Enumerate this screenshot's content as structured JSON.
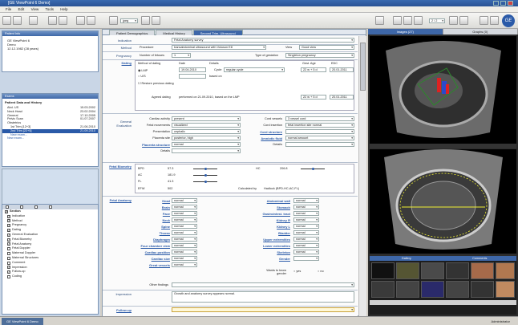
{
  "window": {
    "title": "[GE ViewPoint 6 Demo]"
  },
  "menu": [
    "File",
    "Edit",
    "View",
    "Tools",
    "Help"
  ],
  "toolbar": {
    "zoom": "jpeg",
    "page_sel": "2 / 2"
  },
  "patient_info": {
    "header": "Patient Info",
    "line1": "GE ViewPoint 6",
    "line2": "Demo",
    "line3": "12.12.1982 (28 years)"
  },
  "exams": {
    "header": "Exams",
    "title": "Patient Data and History",
    "rows": [
      {
        "name": "Abd. US",
        "date": "15.03.2002"
      },
      {
        "name": "Neck Head",
        "date": "23.02.2004"
      },
      {
        "name": "General",
        "date": "17.10.2005"
      },
      {
        "name": "Pelvic Scan",
        "date": "01.07.2007"
      },
      {
        "name": "Obstetrics",
        "date": ""
      },
      {
        "name": "1st Trim.[12+3]",
        "date": "21.06.2010"
      },
      {
        "name": "2nd Trim.[22+5]",
        "date": "21.09.2010"
      },
      {
        "name": "New exam...",
        "date": ""
      },
      {
        "name": "New exam...",
        "date": ""
      }
    ]
  },
  "sections": {
    "header": "Section",
    "items": [
      {
        "label": "Indication",
        "checked": true
      },
      {
        "label": "Method",
        "checked": true
      },
      {
        "label": "Pregnancy",
        "checked": true
      },
      {
        "label": "Dating",
        "checked": true
      },
      {
        "label": "General Evaluation",
        "checked": true
      },
      {
        "label": "Fetal Biometry",
        "checked": true
      },
      {
        "label": "Fetal Anatomy",
        "checked": true
      },
      {
        "label": "Fetal Doppler",
        "checked": false
      },
      {
        "label": "Maternal Doppler",
        "checked": false
      },
      {
        "label": "Maternal Structures",
        "checked": false
      },
      {
        "label": "Comment",
        "checked": false
      },
      {
        "label": "Impression",
        "checked": true
      },
      {
        "label": "Follow-up",
        "checked": true
      },
      {
        "label": "Coding",
        "checked": false
      }
    ]
  },
  "tabs": [
    "Patient Demographics",
    "Medical History",
    "Second Trim. Ultrasound"
  ],
  "form": {
    "indication_label": "Indication",
    "indication_val": "Fetal Anatomy survey",
    "method_label": "Method",
    "procedure_label": "Procedure",
    "procedure_val": "transabdominal ultrasound with Voluson E8",
    "view_label": "View",
    "view_val": "Good view",
    "pregnancy_label": "Pregnancy",
    "fetuses_label": "Number of fetuses",
    "fetuses_val": "1",
    "gestation_label": "Type of gestation",
    "gestation_val": "Singleton pregnancy",
    "dating_label": "Dating",
    "dating_hdr": [
      "Method of dating",
      "Date",
      "Details",
      "Gest. Age",
      "EDC"
    ],
    "lmp": "LMP",
    "lmp_date": "19.04.2010",
    "cycle_label": "Cycle",
    "cycle_val": "regular cycle",
    "lmp_ga": "22 w + 5 d",
    "lmp_edc": "20.01.2011",
    "us": "U/S",
    "based_on": "based on",
    "restore": "Restore previous dating",
    "agreed_label": "Agreed dating",
    "agreed_val": "performed on 21.09.2010, based on the LMP",
    "agreed_ga": "22 w + 5 d",
    "agreed_edc": "20.01.2011",
    "genev_label": "General Evaluation",
    "cardiac_activity": "Cardiac activity",
    "cardiac_activity_val": "present",
    "fetal_movements": "Fetal movements",
    "fetal_movements_val": "visualized",
    "presentation": "Presentation",
    "presentation_val": "cephalic",
    "placenta_site": "Placenta site",
    "placenta_site_val": "posterior, high",
    "placenta_structure": "Placenta structure",
    "placenta_structure_val": "normal",
    "details": "Details",
    "cord_vessels": "Cord vessels",
    "cord_vessels_val": "3 vessel cord",
    "cord_insertion": "Cord insertion",
    "cord_insertion_val": "fetal insertion site normal",
    "cord_structure": "Cord structure",
    "amniotic_fluid": "Amniotic fluid",
    "amniotic_fluid_val": "normal amount",
    "biometry_label": "Fetal Biometry",
    "biometry_rows": [
      {
        "name": "BPD",
        "val": "57.3",
        "name2": "HC",
        "val2": "206.8"
      },
      {
        "name": "AC",
        "val": "181.9",
        "name2": "",
        "val2": ""
      },
      {
        "name": "FL",
        "val": "41.3",
        "name2": "",
        "val2": ""
      }
    ],
    "efw_label": "EFW",
    "efw_val": "502",
    "calc_label": "Calculated by",
    "calc_val": "Hadlock (BPD-HC-AC-FL)",
    "anatomy_label": "Fetal Anatomy",
    "anatomy_left": [
      {
        "label": "Head",
        "val": "normal"
      },
      {
        "label": "Brain",
        "val": "normal"
      },
      {
        "label": "Face",
        "val": "normal"
      },
      {
        "label": "Neck",
        "val": "normal"
      },
      {
        "label": "Spine",
        "val": "normal"
      },
      {
        "label": "Thorax",
        "val": "normal"
      },
      {
        "label": "Diaphragm",
        "val": "normal"
      },
      {
        "label": "Four chamber view",
        "val": "normal"
      },
      {
        "label": "Cardiac position",
        "val": "normal"
      },
      {
        "label": "Cardiac size",
        "val": "normal"
      },
      {
        "label": "Great vessels",
        "val": "normal"
      }
    ],
    "anatomy_right": [
      {
        "label": "Abdominal wall",
        "val": "normal"
      },
      {
        "label": "Stomach",
        "val": "normal"
      },
      {
        "label": "Gastrointest. tract",
        "val": "normal"
      },
      {
        "label": "Kidney R",
        "val": "normal"
      },
      {
        "label": "Kidney L",
        "val": "normal"
      },
      {
        "label": "Bladder",
        "val": "normal"
      },
      {
        "label": "Upper extremities",
        "val": "normal"
      },
      {
        "label": "Lower extremities",
        "val": "normal"
      },
      {
        "label": "Skeleton",
        "val": "normal"
      },
      {
        "label": "Gender",
        "val": ""
      }
    ],
    "wants_gender": "Wants to know gender",
    "yes": "yes",
    "no": "no",
    "other_findings": "Other findings",
    "impression_label": "Impression",
    "impression_val": "Growth and anatomy survey appears normal.",
    "followup_label": "Follow-up"
  },
  "right_tabs": [
    "Images (27)",
    "Graphs (0)"
  ],
  "gallery_tabs": [
    "Gallery",
    "Comments"
  ],
  "status": {
    "user": "GE ViewPoint 6 Demo",
    "role": "Administrator"
  }
}
